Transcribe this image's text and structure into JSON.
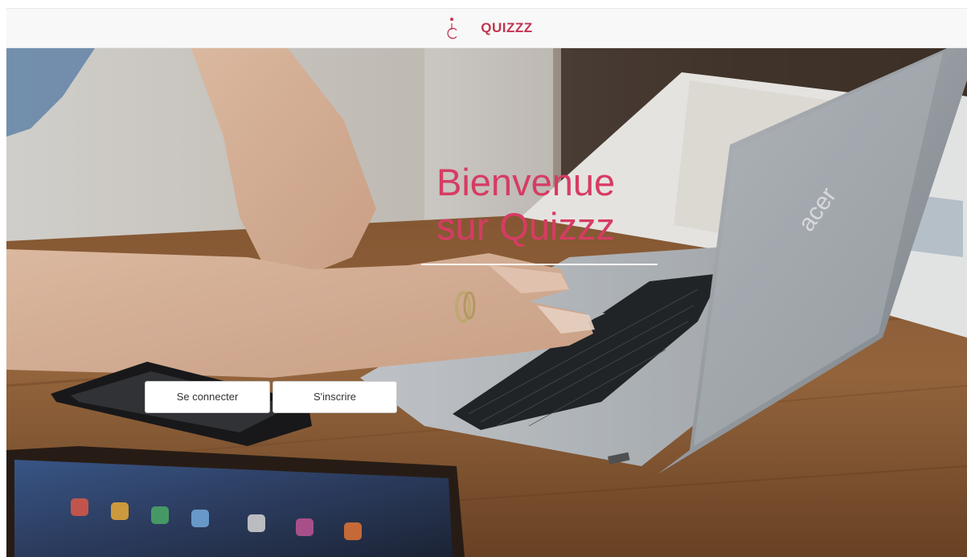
{
  "navbar": {
    "brand_name": "QUIZZZ",
    "logo_icon": "letter-c-logo-icon",
    "brand_color": "#c2344f"
  },
  "hero": {
    "title_line1": "Bienvenue",
    "title_line2": "sur Quizzz",
    "title_color": "#d63c63",
    "background_image": "woman-typing-on-laptop-photo",
    "buttons": {
      "login_label": "Se connecter",
      "signup_label": "S'inscrire"
    }
  }
}
